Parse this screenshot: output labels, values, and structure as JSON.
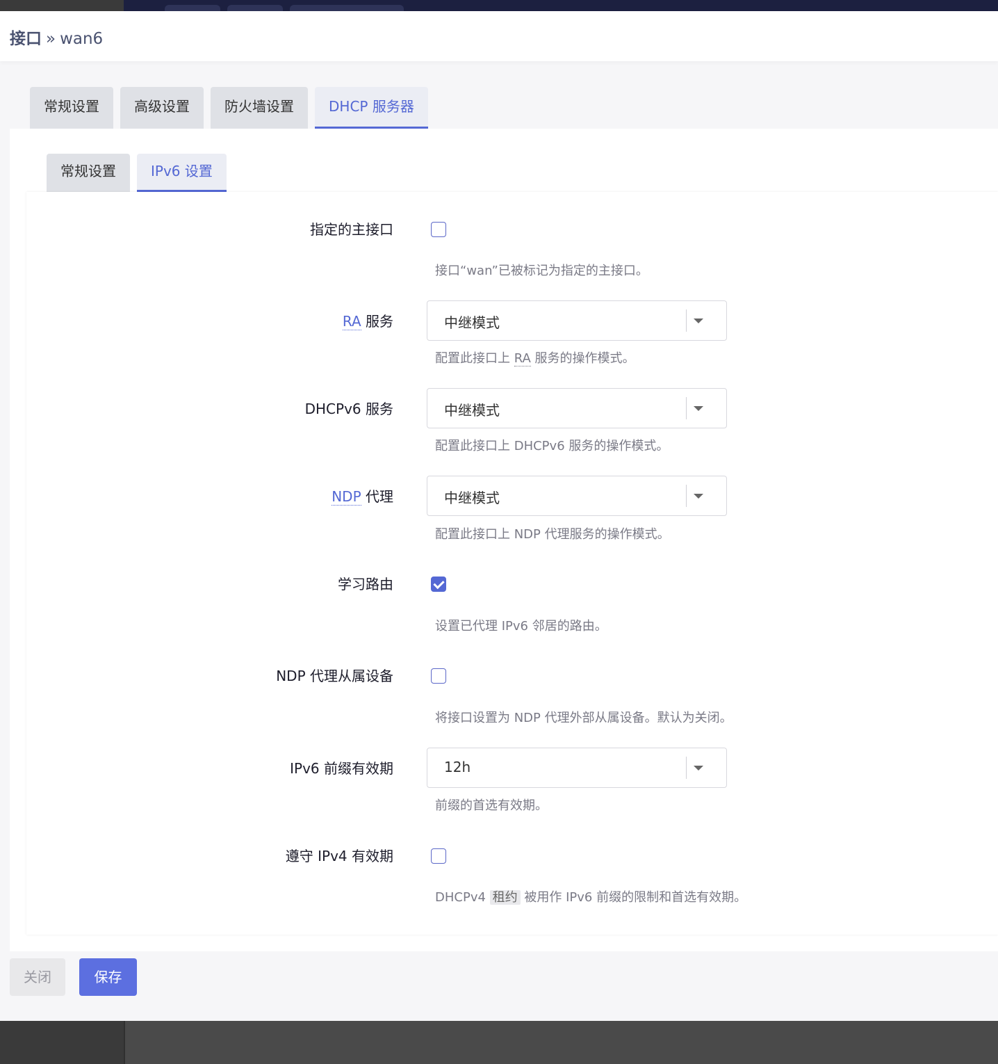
{
  "header": {
    "title_main": "接口",
    "separator": "»",
    "title_sub": "wan6"
  },
  "tabs_outer": [
    {
      "label": "常规设置"
    },
    {
      "label": "高级设置"
    },
    {
      "label": "防火墙设置"
    },
    {
      "label": "DHCP 服务器",
      "active": true
    }
  ],
  "tabs_inner": [
    {
      "label": "常规设置"
    },
    {
      "label": "IPv6 设置",
      "active": true
    }
  ],
  "fields": {
    "master": {
      "label": "指定的主接口",
      "checked": false,
      "help": "接口“wan”已被标记为指定的主接口。"
    },
    "ra": {
      "label_abbr": "RA",
      "label_rest": " 服务",
      "value": "中继模式",
      "help_pre": "配置此接口上 ",
      "help_abbr": "RA",
      "help_post": " 服务的操作模式。"
    },
    "dhcpv6": {
      "label": "DHCPv6 服务",
      "value": "中继模式",
      "help": "配置此接口上 DHCPv6 服务的操作模式。"
    },
    "ndp": {
      "label_abbr": "NDP",
      "label_rest": " 代理",
      "value": "中继模式",
      "help": "配置此接口上 NDP 代理服务的操作模式。"
    },
    "learn_routes": {
      "label": "学习路由",
      "checked": true,
      "help": "设置已代理 IPv6 邻居的路由。"
    },
    "ndp_slave": {
      "label": "NDP 代理从属设备",
      "checked": false,
      "help": "将接口设置为 NDP 代理外部从属设备。默认为关闭。"
    },
    "prefix_lifetime": {
      "label": "IPv6 前缀有效期",
      "value": "12h",
      "help": "前缀的首选有效期。"
    },
    "ipv4_lifetime": {
      "label": "遵守 IPv4 有效期",
      "checked": false,
      "help_pre": "DHCPv4 ",
      "help_kbd": "租约",
      "help_post": " 被用作 IPv6 前缀的限制和首选有效期。"
    }
  },
  "footer": {
    "close_label": "关闭",
    "save_label": "保存"
  },
  "colors": {
    "accent": "#5468d4",
    "save_button": "#5c6fe0",
    "topbar": "#1c2040"
  }
}
